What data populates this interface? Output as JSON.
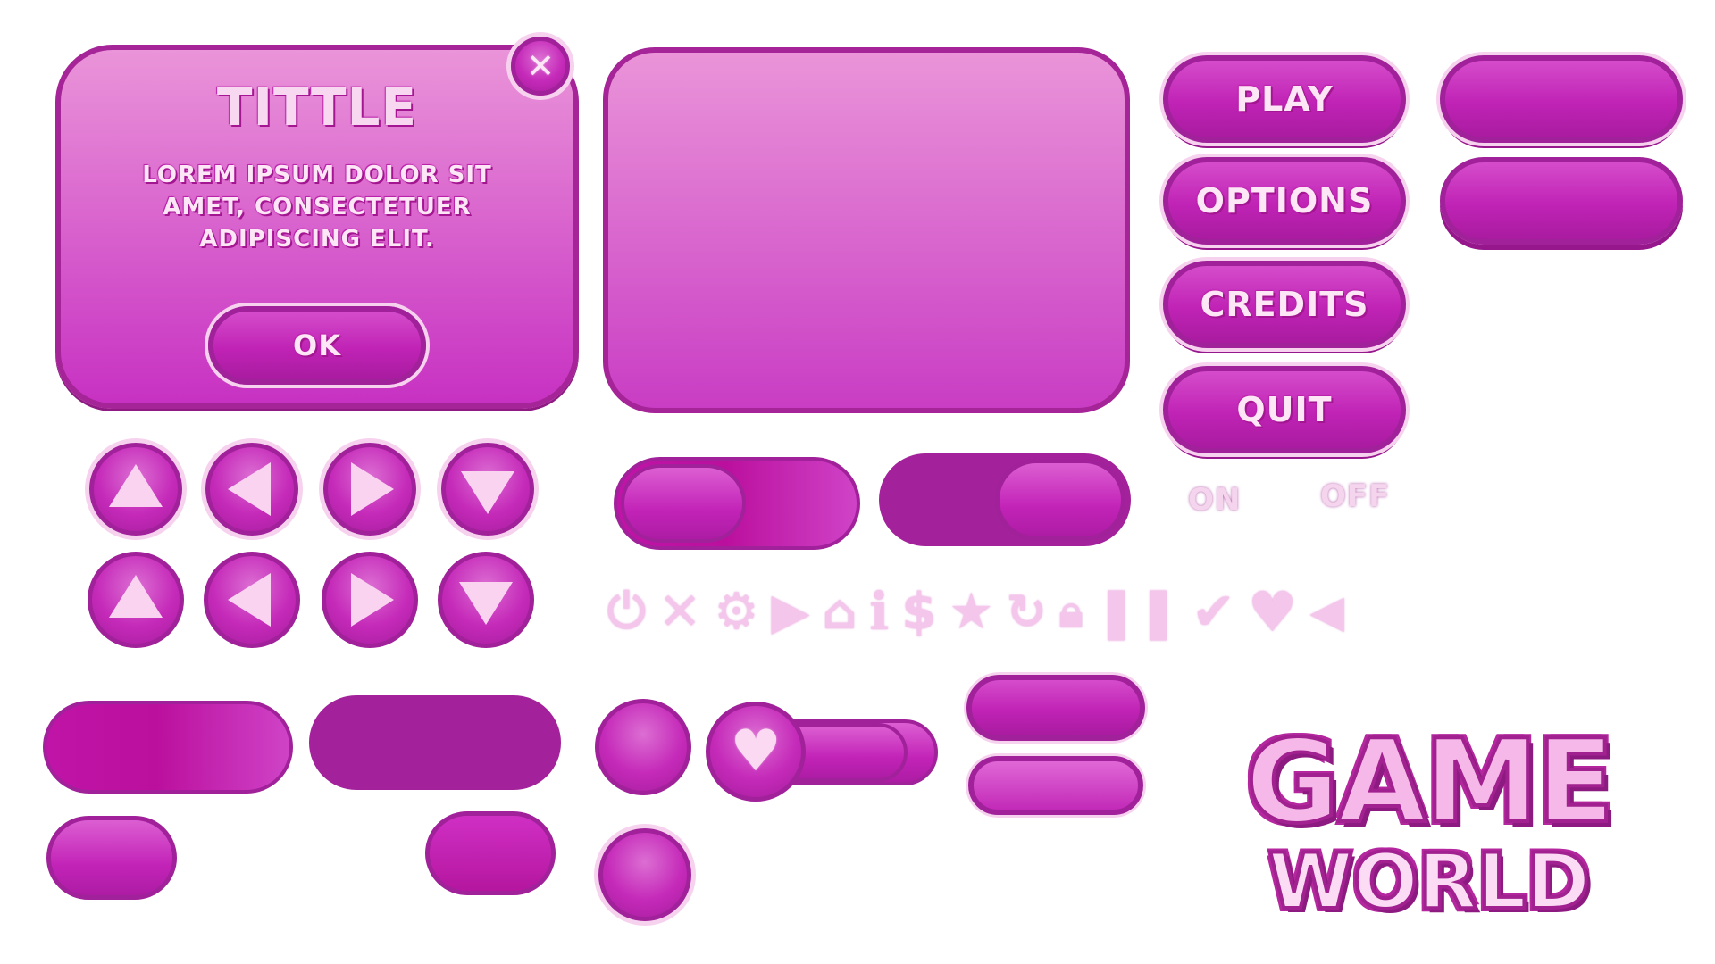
{
  "dialog": {
    "title": "TITTLE",
    "body": "LOREM IPSUM DOLOR SIT AMET, CONSECTETUER ADIPISCING ELIT.",
    "ok_label": "OK",
    "close_icon": "close-icon"
  },
  "menu": {
    "play_label": "PLAY",
    "options_label": "OPTIONS",
    "credits_label": "CREDITS",
    "quit_label": "QUIT"
  },
  "toggle_labels": {
    "on": "ON",
    "off": "OFF"
  },
  "icons": [
    "power-icon",
    "close-icon",
    "gear-icon",
    "play-icon",
    "home-icon",
    "info-icon",
    "dollar-icon",
    "star-icon",
    "refresh-icon",
    "lock-icon",
    "pause-icon",
    "check-icon",
    "heart-icon",
    "speaker-icon"
  ],
  "logo": {
    "line1": "GAME",
    "line2": "WORLD"
  },
  "colors": {
    "primary": "#c52ab9",
    "border": "#a1219a",
    "light": "#f7d2ef",
    "text": "#fde6f6"
  }
}
